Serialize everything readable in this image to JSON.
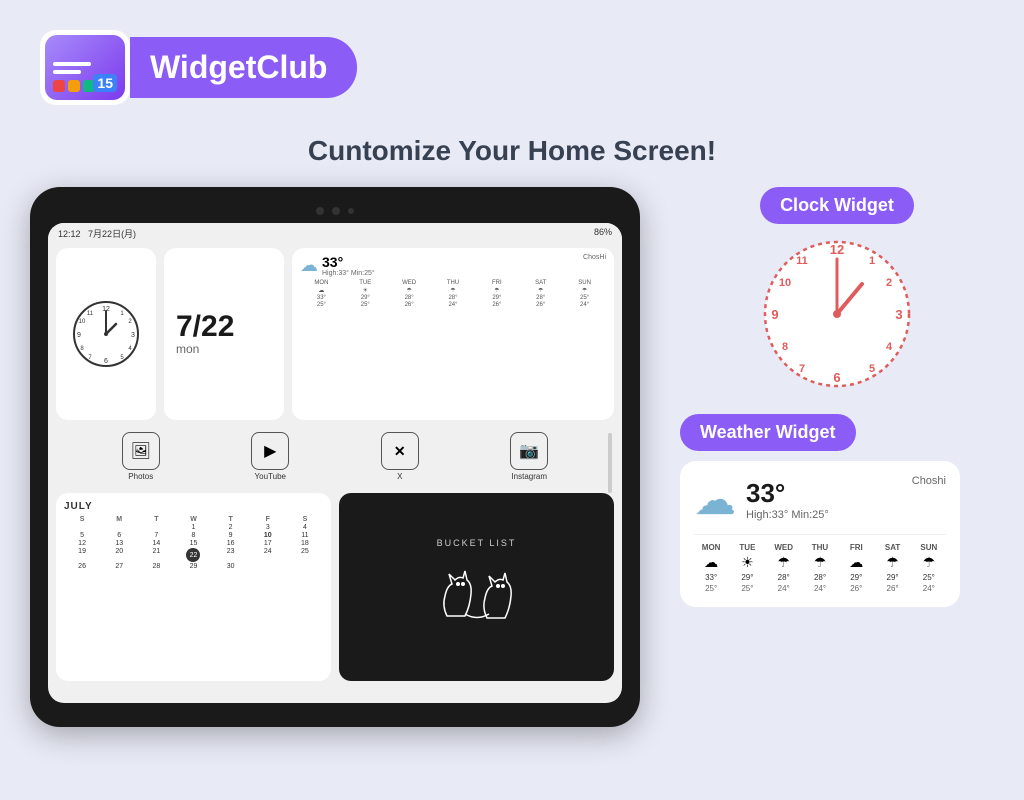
{
  "header": {
    "brand": "WidgetClub",
    "logo_number": "15"
  },
  "tagline": "Cuntomize Your Home Screen!",
  "tablet": {
    "status_bar": {
      "time": "12:12",
      "date": "7月22日(月)",
      "battery": "86%"
    },
    "clock_widget": {
      "label": "Clock"
    },
    "date_widget": {
      "date": "7/22",
      "day": "mon"
    },
    "weather_widget": {
      "temp": "33°",
      "high": "High:33°",
      "low": "Min:25°",
      "location": "ChosHi",
      "days": [
        "MON",
        "TUE",
        "WED",
        "THU",
        "FRI",
        "SAT",
        "SUN"
      ],
      "icons": [
        "☁",
        "☀",
        "☂",
        "☂",
        "☂",
        "☂",
        "☂"
      ],
      "highs": [
        "33°",
        "29°",
        "28°",
        "28°",
        "29°",
        "28°",
        "25°"
      ],
      "lows": [
        "25°",
        "25°",
        "26°",
        "24°",
        "26°",
        "26°",
        "24°"
      ]
    },
    "apps": [
      {
        "label": "Photos",
        "icon": "🖼"
      },
      {
        "label": "YouTube",
        "icon": "▶"
      },
      {
        "label": "X",
        "icon": "𝕏"
      },
      {
        "label": "Instagram",
        "icon": "📷"
      }
    ],
    "calendar": {
      "month": "JULY",
      "headers": [
        "S",
        "M",
        "T",
        "W",
        "T",
        "F",
        "S"
      ],
      "weeks": [
        [
          "",
          "",
          "",
          "1",
          "2",
          "3",
          "4"
        ],
        [
          "5",
          "6",
          "7",
          "8",
          "9",
          "10",
          "11"
        ],
        [
          "12",
          "13",
          "14",
          "15",
          "16",
          "17",
          "18"
        ],
        [
          "19",
          "20",
          "21",
          "22",
          "23",
          "24",
          "25"
        ],
        [
          "26",
          "27",
          "28",
          "29",
          "30",
          "",
          ""
        ]
      ],
      "today": "22"
    },
    "bucket_list": {
      "title": "Bucket List"
    }
  },
  "right_panel": {
    "clock_widget": {
      "label": "Clock Widget"
    },
    "weather_widget": {
      "label": "Weather Widget",
      "temp": "33°",
      "high": "High:33°",
      "min": "Min:25°",
      "location": "Choshi",
      "days": [
        "MON",
        "TUE",
        "WED",
        "THU",
        "FRI",
        "SAT",
        "SUN"
      ],
      "icons": [
        "☁",
        "☀",
        "☂",
        "☂",
        "☁",
        "☂",
        "☂"
      ],
      "highs": [
        "33°",
        "29°",
        "28°",
        "28°",
        "29°",
        "29°",
        "25°"
      ],
      "lows": [
        "25°",
        "25°",
        "24°",
        "24°",
        "26°",
        "26°",
        "24°"
      ]
    }
  },
  "background_color": "#e8eaf6",
  "accent_color": "#8b5cf6"
}
